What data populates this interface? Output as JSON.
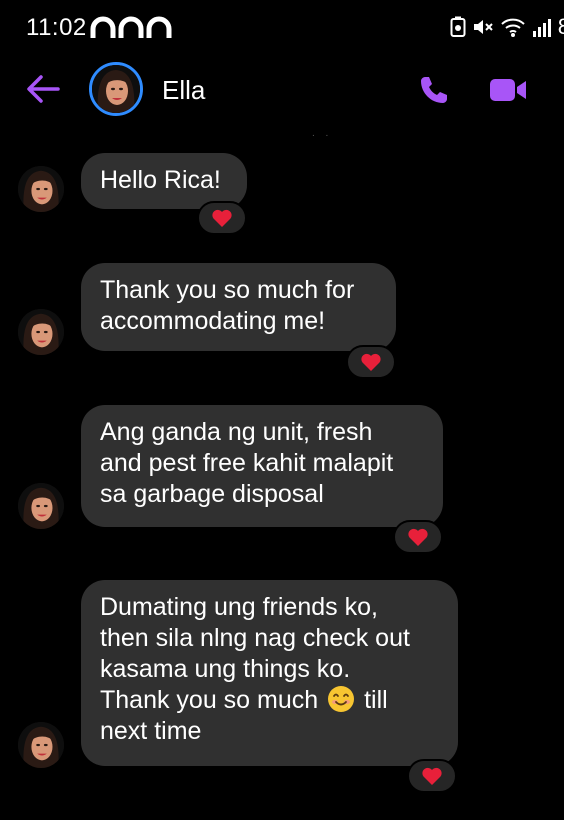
{
  "status_bar": {
    "time": "11:02",
    "battery_text": "8",
    "icons": [
      "arch-notification-icon",
      "battery-saver-icon",
      "mute-icon",
      "wifi-icon",
      "signal-icon"
    ]
  },
  "header": {
    "contact_name": "Ella",
    "back_icon": "arrow-left-icon",
    "call_icon": "phone-icon",
    "video_icon": "video-camera-icon",
    "accent_color": "#a855f7",
    "avatar_ring_color": "#2f8cff"
  },
  "messages": [
    {
      "lines": [
        "Hello Rica!"
      ],
      "reaction": "heart"
    },
    {
      "lines": [
        "Thank you so much for",
        "accommodating me!"
      ],
      "reaction": "heart"
    },
    {
      "lines": [
        "Ang ganda ng unit, fresh",
        "and pest free kahit malapit",
        "sa garbage disposal"
      ],
      "reaction": "heart"
    },
    {
      "lines": [
        "Dumating ung friends ko,",
        "then sila nlng nag check out",
        "kasama ung things ko."
      ],
      "line4_before": "Thank you so much",
      "line4_emoji": "smiling-face-icon",
      "line4_after": "till",
      "line5": "next time",
      "reaction": "heart"
    }
  ],
  "colors": {
    "background": "#000000",
    "bubble": "#303030",
    "heart": "#e8203a"
  }
}
